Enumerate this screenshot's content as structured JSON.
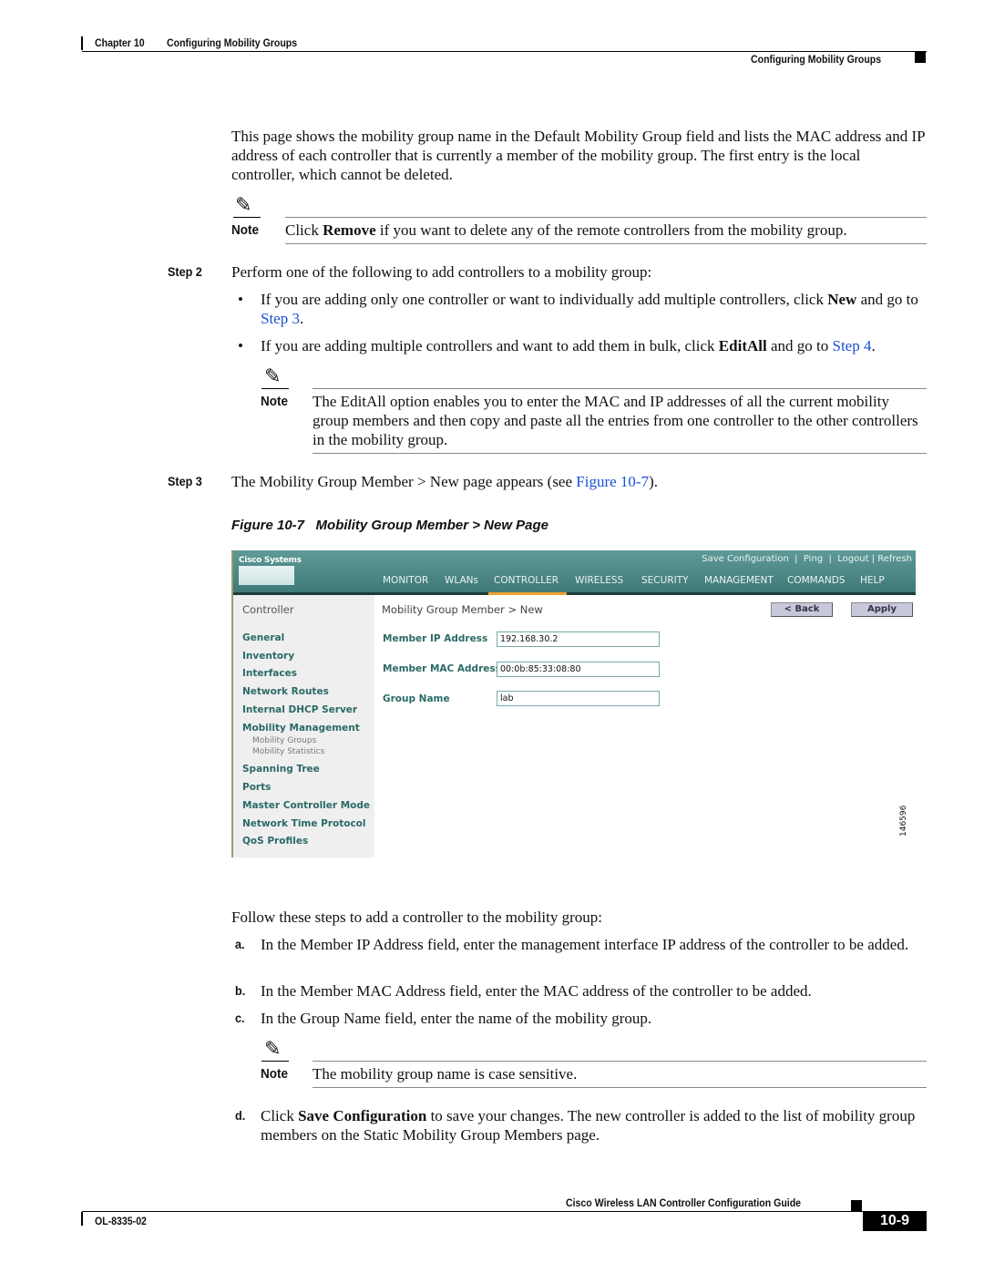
{
  "header": {
    "chapter": "Chapter 10",
    "chapter_title": "Configuring Mobility Groups",
    "section_title": "Configuring Mobility Groups"
  },
  "intro": "This page shows the mobility group name in the Default Mobility Group field and lists the MAC address and IP address of each controller that is currently a member of the mobility group. The first entry is the local controller, which cannot be deleted.",
  "note1": {
    "label": "Note",
    "pre": "Click ",
    "bold": "Remove",
    "post": " if you want to delete any of the remote controllers from the mobility group."
  },
  "step2": {
    "label": "Step 2",
    "text": "Perform one of the following to add controllers to a mobility group:",
    "b1": {
      "pre": "If you are adding only one controller or want to individually add multiple controllers, click ",
      "bold": "New",
      "mid": " and go to ",
      "link": "Step 3",
      "post": "."
    },
    "b2": {
      "pre": "If you are adding multiple controllers and want to add them in bulk, click ",
      "bold": "EditAll",
      "mid": " and go to ",
      "link": "Step 4",
      "post": "."
    },
    "note": {
      "label": "Note",
      "text": "The EditAll option enables you to enter the MAC and IP addresses of all the current mobility group members and then copy and paste all the entries from one controller to the other controllers in the mobility group."
    }
  },
  "step3": {
    "label": "Step 3",
    "pre": "The Mobility Group Member > New page appears (see ",
    "link": "Figure 10-7",
    "post": ")."
  },
  "figure": {
    "number": "Figure 10-7",
    "title": "Mobility Group Member > New Page",
    "id": "146596",
    "ui": {
      "logo": "Cisco Systems",
      "top_links": [
        "Save Configuration",
        "Ping",
        "Logout",
        "Refresh"
      ],
      "menu": [
        "MONITOR",
        "WLANs",
        "CONTROLLER",
        "WIRELESS",
        "SECURITY",
        "MANAGEMENT",
        "COMMANDS",
        "HELP"
      ],
      "active_menu": "CONTROLLER",
      "sidebar_title": "Controller",
      "sidebar": [
        "General",
        "Inventory",
        "Interfaces",
        "Network Routes",
        "Internal DHCP Server",
        "Mobility Management",
        "Spanning Tree",
        "Ports",
        "Master Controller Mode",
        "Network Time Protocol",
        "QoS Profiles"
      ],
      "sidebar_sub": [
        "Mobility Groups",
        "Mobility Statistics"
      ],
      "page_title": "Mobility Group Member > New",
      "back": "< Back",
      "apply": "Apply",
      "fields": [
        {
          "label": "Member IP Address",
          "value": "192.168.30.2"
        },
        {
          "label": "Member MAC Address",
          "value": "00:0b:85:33:08:80"
        },
        {
          "label": "Group Name",
          "value": "lab"
        }
      ]
    }
  },
  "follow": "Follow these steps to add a controller to the mobility group:",
  "sub": [
    {
      "l": "a.",
      "t": "In the Member IP Address field, enter the management interface IP address of the controller to be added."
    },
    {
      "l": "b.",
      "t": "In the Member MAC Address field, enter the MAC address of the controller to be added."
    },
    {
      "l": "c.",
      "t": "In the Group Name field, enter the name of the mobility group."
    }
  ],
  "note3": {
    "label": "Note",
    "text": "The mobility group name is case sensitive."
  },
  "d": {
    "l": "d.",
    "pre": "Click ",
    "bold": "Save Configuration",
    "post": " to save your changes. The new controller is added to the list of mobility group members on the Static Mobility Group Members page."
  },
  "footer": {
    "guide": "Cisco Wireless LAN Controller Configuration Guide",
    "doc": "OL-8335-02",
    "page": "10-9"
  }
}
